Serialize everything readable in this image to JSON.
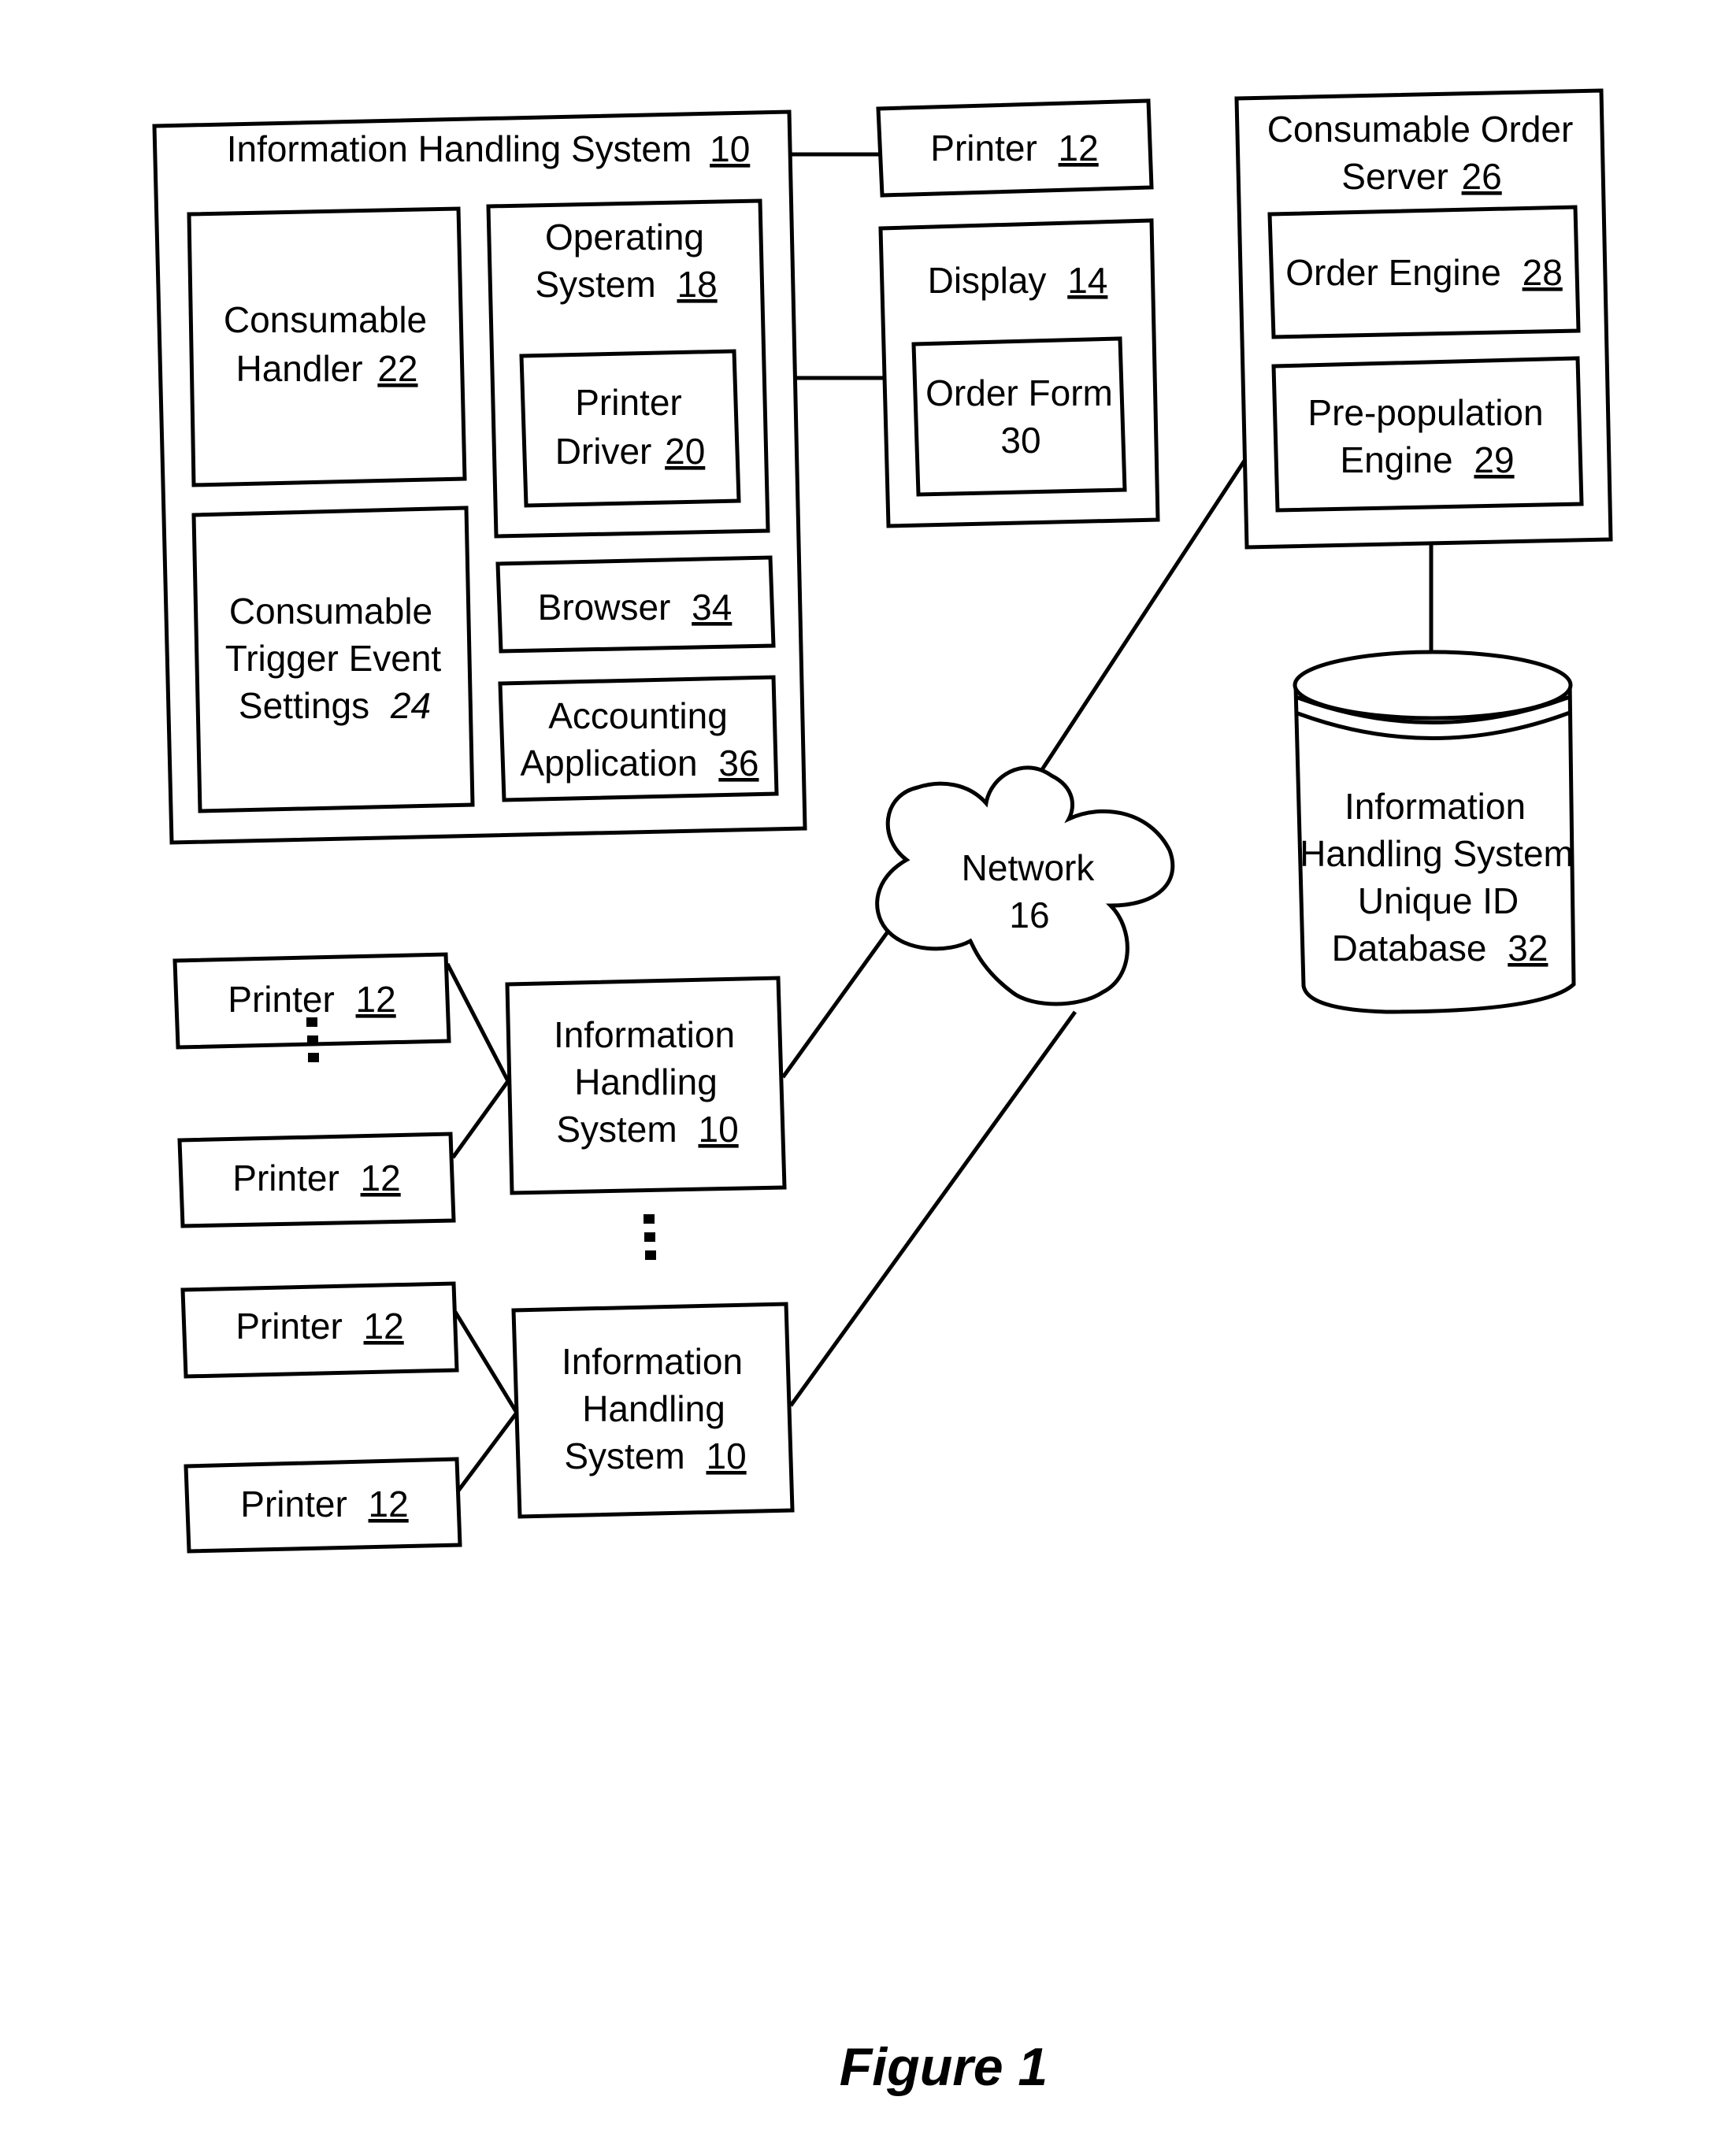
{
  "figure": {
    "caption": "Figure 1"
  },
  "main_ihs": {
    "title": "Information Handling System",
    "title_num": "10",
    "consumable_handler": {
      "line1": "Consumable",
      "line2": "Handler",
      "num": "22"
    },
    "operating_system": {
      "line1": "Operating",
      "line2": "System",
      "num": "18"
    },
    "printer_driver": {
      "line1": "Printer",
      "line2": "Driver",
      "num": "20"
    },
    "trigger_settings": {
      "line1": "Consumable",
      "line2": "Trigger Event",
      "line3": "Settings",
      "num": "24"
    },
    "browser": {
      "label": "Browser",
      "num": "34"
    },
    "accounting": {
      "line1": "Accounting",
      "line2": "Application",
      "num": "36"
    }
  },
  "printer_top": {
    "label": "Printer",
    "num": "12"
  },
  "display": {
    "label": "Display",
    "num": "14",
    "order_form": {
      "label": "Order Form",
      "num": "30"
    }
  },
  "order_server": {
    "line1": "Consumable Order",
    "line2": "Server",
    "num": "26",
    "order_engine": {
      "label": "Order Engine",
      "num": "28"
    },
    "prepop_engine": {
      "line1": "Pre-population",
      "line2": "Engine",
      "num": "29"
    }
  },
  "database": {
    "line1": "Information",
    "line2": "Handling System",
    "line3": "Unique ID",
    "line4": "Database",
    "num": "32"
  },
  "network": {
    "label": "Network",
    "num": "16"
  },
  "client_groups": [
    {
      "ihs": {
        "line1": "Information",
        "line2": "Handling",
        "line3": "System",
        "num": "10"
      },
      "printers": [
        {
          "label": "Printer",
          "num": "12"
        },
        {
          "label": "Printer",
          "num": "12"
        }
      ]
    },
    {
      "ihs": {
        "line1": "Information",
        "line2": "Handling",
        "line3": "System",
        "num": "10"
      },
      "printers": [
        {
          "label": "Printer",
          "num": "12"
        },
        {
          "label": "Printer",
          "num": "12"
        }
      ]
    }
  ]
}
